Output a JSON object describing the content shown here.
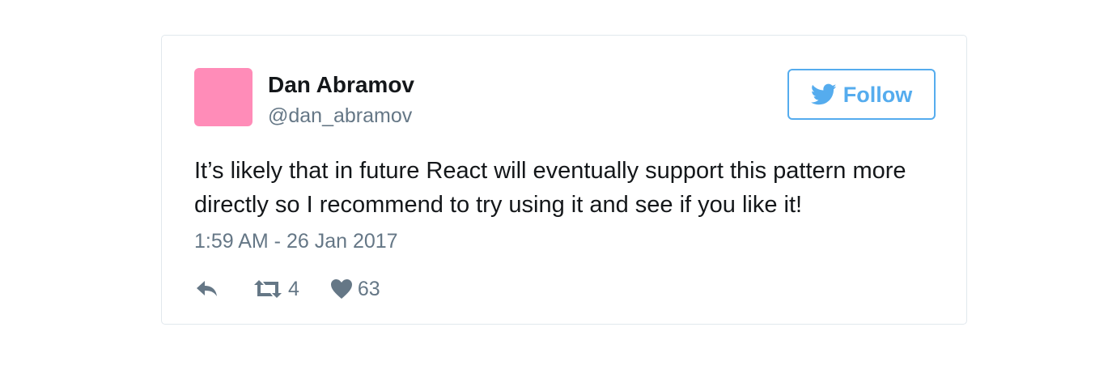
{
  "tweet": {
    "author": {
      "name": "Dan Abramov",
      "handle": "@dan_abramov",
      "avatar_color": "#ff8cb8"
    },
    "follow_button": {
      "label": "Follow",
      "icon": "twitter-bird-icon",
      "color": "#55acee"
    },
    "text": "It’s likely that in future React will eventually support this pattern more directly so I recommend to try using it and see if you like it!",
    "timestamp": "1:59 AM - 26 Jan 2017",
    "actions": {
      "reply_icon": "reply-icon",
      "retweet_icon": "retweet-icon",
      "retweet_count": "4",
      "like_icon": "heart-icon",
      "like_count": "63"
    }
  }
}
